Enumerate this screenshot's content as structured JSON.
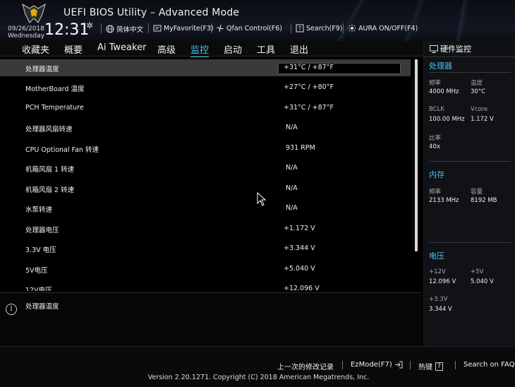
{
  "header": {
    "title": "UEFI BIOS Utility – Advanced Mode",
    "date": "09/26/2018",
    "weekday": "Wednesday",
    "time": "12:31",
    "items": [
      {
        "label": "简体中文",
        "icon": "globe-icon"
      },
      {
        "label": "MyFavorite(F3)",
        "icon": "favorite-icon"
      },
      {
        "label": "Qfan Control(F6)",
        "icon": "fan-icon"
      },
      {
        "label": "Search(F9)",
        "icon": "search-icon"
      },
      {
        "label": "AURA ON/OFF(F4)",
        "icon": "aura-icon"
      }
    ]
  },
  "menu": {
    "active": "监控",
    "items": [
      "收藏夹",
      "概要",
      "Ai Tweaker",
      "高级",
      "监控",
      "启动",
      "工具",
      "退出"
    ]
  },
  "monitor_rows": [
    {
      "label": "处理器温度",
      "value": "+31°C / +87°F",
      "selected": true
    },
    {
      "label": "MotherBoard 温度",
      "value": "+27°C / +80°F"
    },
    {
      "label": "PCH Temperature",
      "value": "+31°C / +87°F"
    },
    {
      "label": "处理器风扇转速",
      "value": "N/A"
    },
    {
      "label": "CPU Optional Fan 转速",
      "value": "931 RPM"
    },
    {
      "label": "机箱风扇 1 转速",
      "value": "N/A"
    },
    {
      "label": "机箱风扇 2 转速",
      "value": "N/A"
    },
    {
      "label": "水泵转速",
      "value": "N/A"
    },
    {
      "label": "处理器电压",
      "value": "+1.172 V"
    },
    {
      "label": "3.3V 电压",
      "value": "+3.344 V"
    },
    {
      "label": "5V电压",
      "value": "+5.040 V"
    },
    {
      "label": "12V电压",
      "value": "+12.096 V"
    }
  ],
  "help": {
    "text": "处理器温度"
  },
  "hw_monitor": {
    "title": "硬件监控",
    "cpu": {
      "title": "处理器",
      "freq_label": "频率",
      "freq_value": "4000 MHz",
      "temp_label": "温度",
      "temp_value": "30°C",
      "bclk_label": "BCLK",
      "bclk_value": "100.00 MHz",
      "vcore_label": "Vcore",
      "vcore_value": "1.172 V",
      "ratio_label": "比率",
      "ratio_value": "40x"
    },
    "memory": {
      "title": "内存",
      "freq_label": "频率",
      "freq_value": "2133 MHz",
      "cap_label": "容量",
      "cap_value": "8192 MB"
    },
    "voltage": {
      "title": "电压",
      "v12_label": "+12V",
      "v12_value": "12.096 V",
      "v5_label": "+5V",
      "v5_value": "5.040 V",
      "v33_label": "+3.3V",
      "v33_value": "3.344 V"
    }
  },
  "footer": {
    "last_changes": "上一次的修改记录",
    "ezmode": "EzMode(F7)",
    "hotkeys": "热键",
    "hotkeys_key": "?",
    "faq": "Search on FAQ",
    "copyright": "Version 2.20.1271. Copyright (C) 2018 American Megatrends, Inc."
  },
  "colors": {
    "accent": "#3fc7f5",
    "background": "#000000",
    "panel": "#101215"
  }
}
